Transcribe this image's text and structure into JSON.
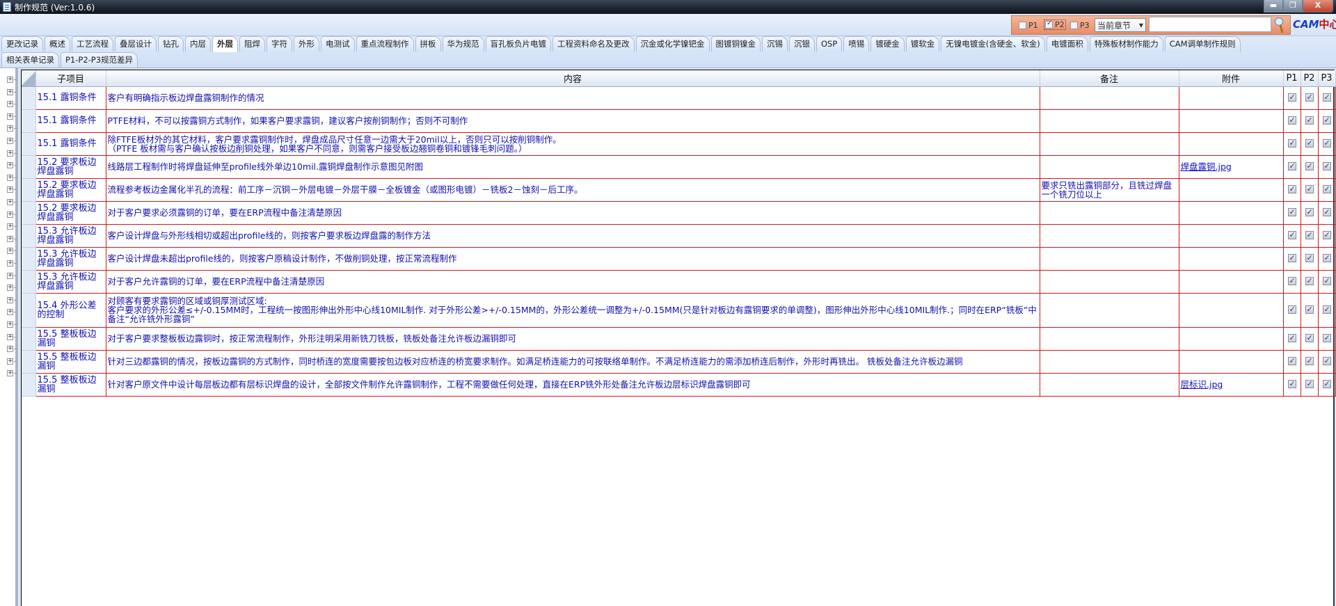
{
  "window": {
    "title": "制作规范 (Ver:1.0.6)",
    "buttons": [
      "▬",
      "❐",
      "X"
    ]
  },
  "toolbar": {
    "filters": [
      {
        "label": "P1",
        "checked": false
      },
      {
        "label": "P2",
        "checked": true
      },
      {
        "label": "P3",
        "checked": false
      }
    ],
    "scope_select": "当前章节",
    "search_value": "",
    "logo": {
      "main": "CAM",
      "accent": "中心"
    }
  },
  "tabs": {
    "row1": [
      "更改记录",
      "概述",
      "工艺流程",
      "叠层设计",
      "钻孔",
      "内层",
      "外层",
      "阻焊",
      "字符",
      "外形",
      "电测试",
      "重点流程制作",
      "拼板",
      "华为规范",
      "盲孔板负片电镀",
      "工程资料命名及更改",
      "沉金或化学镍钯金",
      "图镀铜镍金",
      "沉锡",
      "沉银",
      "OSP",
      "喷锡",
      "镀硬金",
      "镀软金",
      "无镍电镀金(含硬金、软金)",
      "电镀面积",
      "特殊板材制作能力",
      "CAM调单制作规则"
    ],
    "row2": [
      "相关表单记录",
      "P1-P2-P3规范差异"
    ],
    "active": "外层"
  },
  "grid": {
    "headers": [
      "子项目",
      "内容",
      "备注",
      "附件",
      "P1",
      "P2",
      "P3"
    ],
    "rows": [
      {
        "sub": "15.1 露铜条件",
        "content": "客户有明确指示板边焊盘露铜制作的情况",
        "note": "",
        "attach": "",
        "p": [
          true,
          true,
          true
        ]
      },
      {
        "sub": "15.1 露铜条件",
        "content": "PTFE材料，不可以按露铜方式制作，如果客户要求露铜，建议客户按削铜制作；否则不可制作",
        "note": "",
        "attach": "",
        "p": [
          true,
          true,
          true
        ]
      },
      {
        "sub": "15.1 露铜条件",
        "content": "除FTFE板材外的其它材料，客户要求露铜制作时，焊盘成品尺寸任意一边需大于20mil以上，否则只可以按削铜制作。\n（PTFE 板材需与客户确认按板边削铜处理，如果客户不同意，则需客户接受板边翘铜卷铜和镀锋毛刺问题。）",
        "note": "",
        "attach": "",
        "p": [
          true,
          true,
          true
        ]
      },
      {
        "sub": "15.2 要求板边焊盘露铜",
        "content": "线路层工程制作时将焊盘延伸至profile线外单边10mil.露铜焊盘制作示意图见附图",
        "note": "",
        "attach": "焊盘露铜.jpg",
        "p": [
          true,
          true,
          true
        ]
      },
      {
        "sub": "15.2 要求板边焊盘露铜",
        "content": "流程参考板边金属化半孔的流程：前工序－沉铜－外层电镀－外层干膜－全板镀金（或图形电镀）－铣板2－蚀刻－后工序。",
        "note": "要求只铣出露铜部分，且铣过焊盘一个铣刀位以上",
        "attach": "",
        "p": [
          true,
          true,
          true
        ]
      },
      {
        "sub": "15.2 要求板边焊盘露铜",
        "content": "对于客户要求必须露铜的订单，要在ERP流程中备注清楚原因",
        "note": "",
        "attach": "",
        "p": [
          true,
          true,
          true
        ]
      },
      {
        "sub": "15.3 允许板边焊盘露铜",
        "content": "客户设计焊盘与外形线相切或超出profile线的，则按客户要求板边焊盘露的制作方法",
        "note": "",
        "attach": "",
        "p": [
          true,
          true,
          true
        ]
      },
      {
        "sub": "15.3 允许板边焊盘露铜",
        "content": "客户设计焊盘未超出profile线的，则按客户原稿设计制作，不做削铜处理，按正常流程制作",
        "note": "",
        "attach": "",
        "p": [
          true,
          true,
          true
        ]
      },
      {
        "sub": "15.3 允许板边焊盘露铜",
        "content": "对于客户允许露铜的订单，要在ERP流程中备注清楚原因",
        "note": "",
        "attach": "",
        "p": [
          true,
          true,
          true
        ]
      },
      {
        "sub": "15.4 外形公差的控制",
        "content": "对顾客有要求露铜的区域或铜厚测试区域:\n客户要求的外形公差≤+/-0.15MM时，工程统一按图形伸出外形中心线10MIL制作. 对于外形公差>+/-0.15MM的，外形公差统一调整为+/-0.15MM(只是针对板边有露铜要求的单调整)，图形伸出外形中心线10MIL制作.；同时在ERP“铣板”中备注“允许铣外形露铜”",
        "note": "",
        "attach": "",
        "p": [
          true,
          true,
          true
        ]
      },
      {
        "sub": "15.5 整板板边漏铜",
        "content": "对于客户要求整板板边露铜时，按正常流程制作，外形注明采用新铣刀铣板，铣板处备注允许板边漏铜即可",
        "note": "",
        "attach": "",
        "p": [
          true,
          true,
          true
        ]
      },
      {
        "sub": "15.5 整板板边漏铜",
        "content": "针对三边都露铜的情况，按板边露铜的方式制作，同时桥连的宽度需要按包边板对应桥连的桥宽要求制作。如满足桥连能力的可按联络单制作。不满足桥连能力的需添加桥连后制作，外形时再铣出。 铣板处备注允许板边漏铜",
        "note": "",
        "attach": "",
        "p": [
          true,
          true,
          true
        ]
      },
      {
        "sub": "15.5 整板板边漏铜",
        "content": "针对客户原文件中设计每层板边都有层标识焊盘的设计，全部按文件制作允许露铜制作，工程不需要做任何处理，直接在ERP铣外形处备注允许板边层标识焊盘露铜即可",
        "note": "",
        "attach": "层标识.jpg",
        "p": [
          true,
          true,
          true
        ]
      }
    ]
  },
  "colors": {
    "grid_line": "#d01818",
    "text": "#1010b0",
    "filter_panel": "#e88c6a"
  }
}
